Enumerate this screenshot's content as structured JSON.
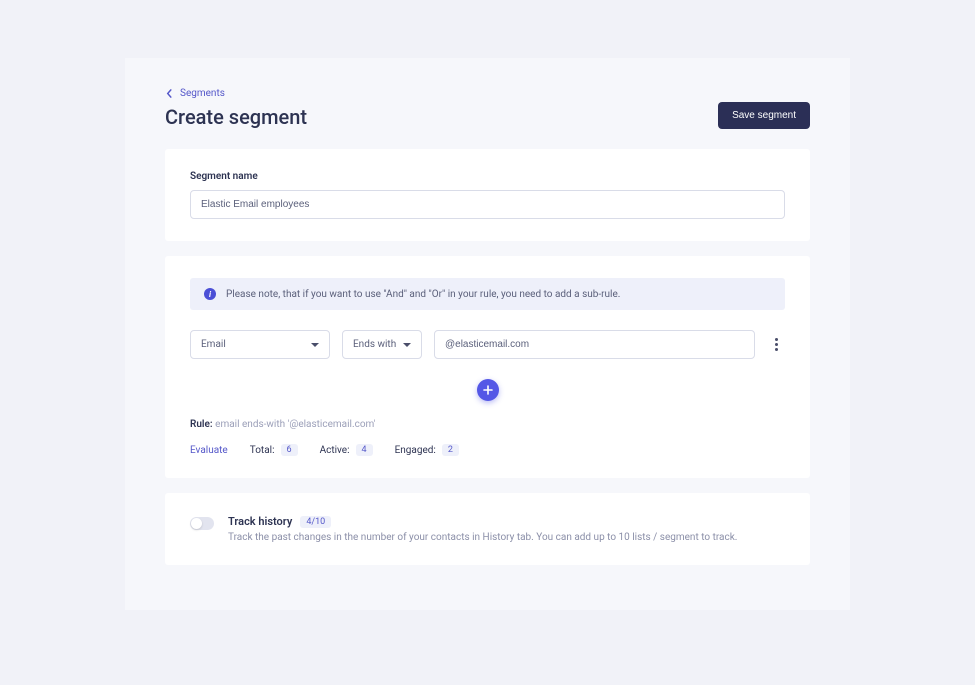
{
  "breadcrumb": {
    "label": "Segments"
  },
  "page": {
    "title": "Create segment"
  },
  "actions": {
    "save_label": "Save segment"
  },
  "segment_name": {
    "label": "Segment name",
    "value": "Elastic Email employees"
  },
  "info": {
    "text": "Please note, that if you want to use \"And\" and \"Or\" in your rule, you need to add a sub-rule."
  },
  "rule": {
    "field": "Email",
    "operator": "Ends with",
    "value": "@elasticemail.com",
    "summary_label": "Rule:",
    "summary_expr": "email ends-with '@elasticemail.com'"
  },
  "stats": {
    "evaluate_label": "Evaluate",
    "total_label": "Total:",
    "total_value": "6",
    "active_label": "Active:",
    "active_value": "4",
    "engaged_label": "Engaged:",
    "engaged_value": "2"
  },
  "track": {
    "title": "Track history",
    "count": "4/10",
    "description": "Track the past changes in the number of your contacts in History tab. You can add up to 10 lists / segment to track."
  }
}
